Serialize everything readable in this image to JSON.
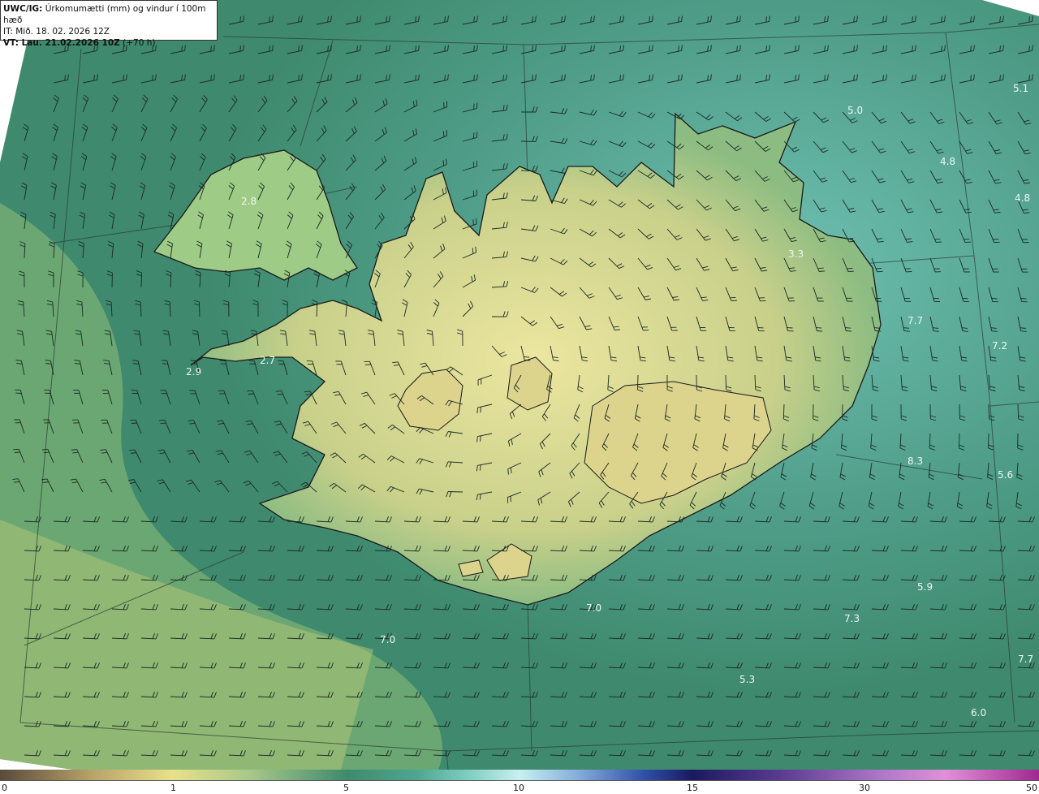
{
  "header": {
    "model": "UWC/IG:",
    "description": "Úrkomumætti (mm) og vindur í 100m hæð",
    "init_time": "IT: Mið. 18. 02. 2026 12Z",
    "valid_prefix": "VT: Lau. 21.02.2026 10Z",
    "valid_suffix": "(+70 h)"
  },
  "colorbar": {
    "ticks": [
      "0",
      "1",
      "5",
      "10",
      "15",
      "30",
      "50"
    ]
  },
  "value_labels": [
    "5.1",
    "5.0",
    "4.8",
    "4.8",
    "2.8",
    "3.3",
    "7.7",
    "7.2",
    "2.7",
    "2.9",
    "8.3",
    "5.6",
    "7.0",
    "5.9",
    "7.3",
    "7.0",
    "5.3",
    "7.7",
    "6.0"
  ],
  "colors": {
    "ocean": "#3f8a6e",
    "ocean_light": "#7ecdc0",
    "land": "#e2dc8a",
    "coast": "#1a1a1a"
  }
}
